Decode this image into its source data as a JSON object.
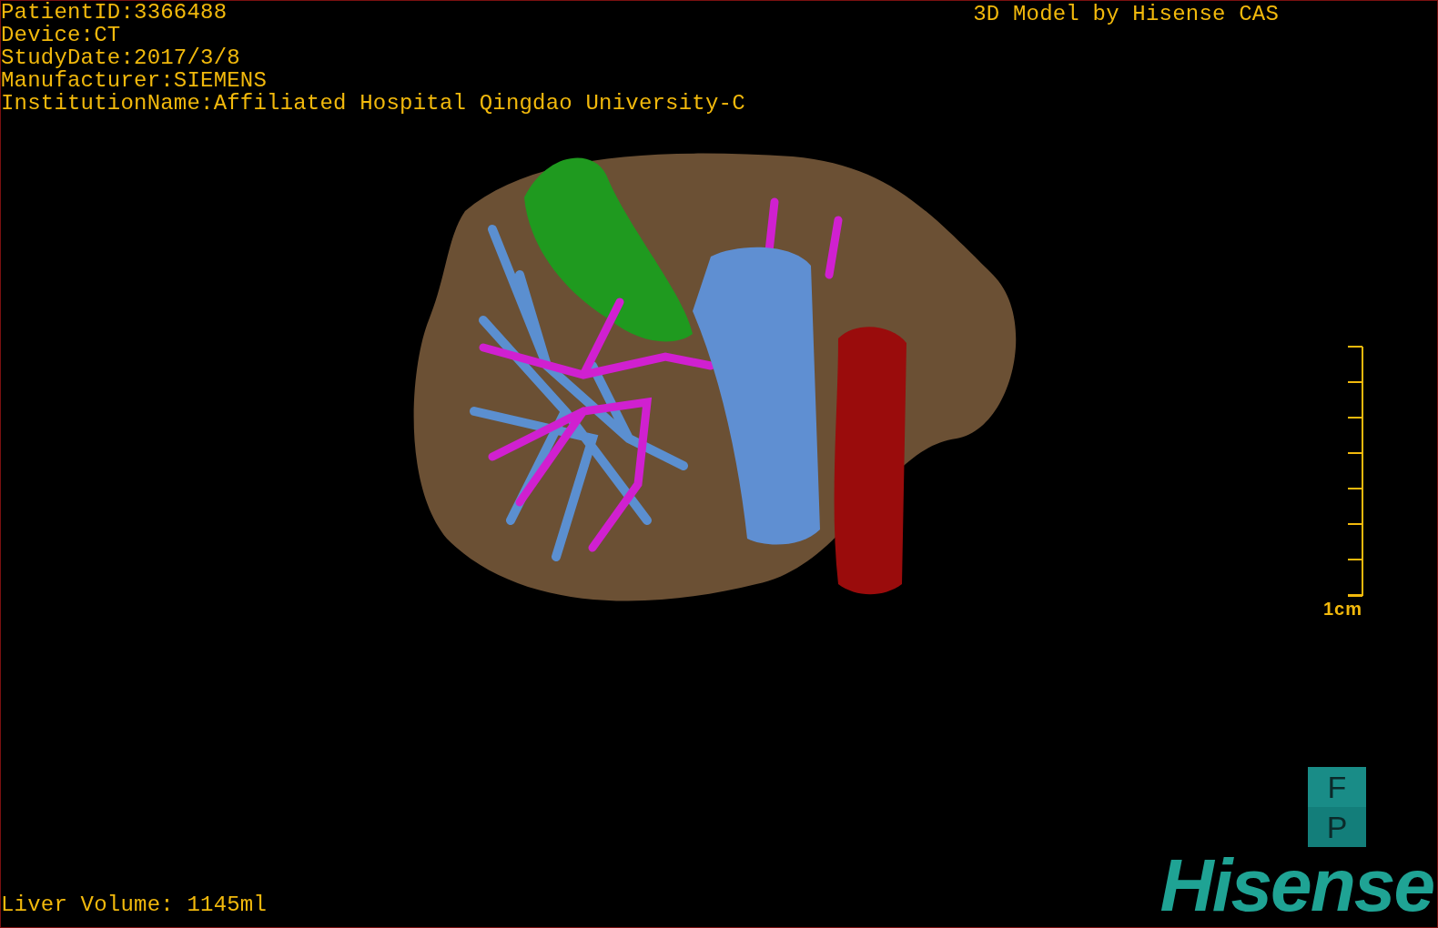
{
  "patient_info": [
    "PatientID:3366488",
    "Device:CT",
    "StudyDate:2017/3/8",
    "Manufacturer:SIEMENS",
    "InstitutionName:Affiliated Hospital Qingdao University-C"
  ],
  "title": "3D Model by Hisense CAS",
  "scale": {
    "label": "1cm"
  },
  "orientation_cube": {
    "top": "F",
    "bottom": "P"
  },
  "liver_volume": "Liver Volume: 1145ml",
  "logo": "Hisense"
}
